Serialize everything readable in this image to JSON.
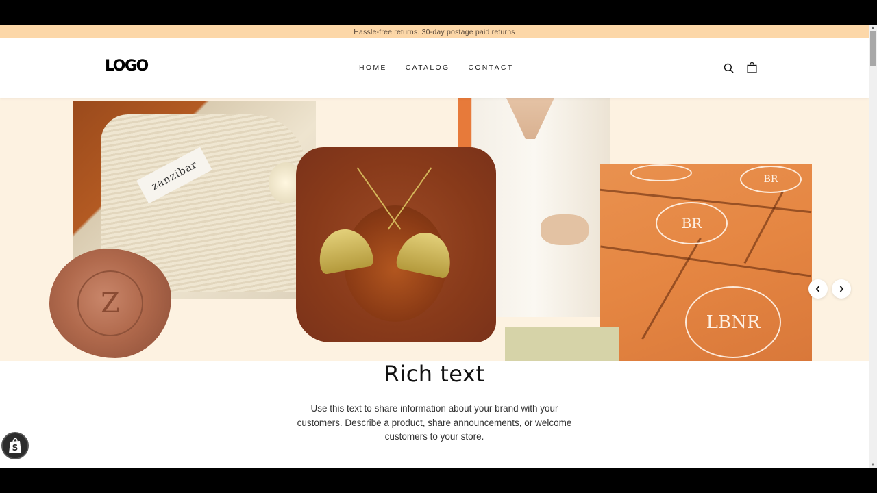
{
  "announcement": {
    "text": "Hassle-free returns. 30-day postage paid returns"
  },
  "header": {
    "logo": "LOGO",
    "nav": [
      {
        "label": "HOME"
      },
      {
        "label": "CATALOG"
      },
      {
        "label": "CONTACT"
      }
    ],
    "icons": {
      "search": "search-icon",
      "cart": "shopping-bag-icon"
    }
  },
  "hero": {
    "images": [
      {
        "name": "fabric-pouch-photo",
        "label_text": "zanzibar"
      },
      {
        "name": "wax-seal-photo",
        "seal_letter": "Z"
      },
      {
        "name": "ginkgo-earrings-photo"
      },
      {
        "name": "white-dress-photo"
      },
      {
        "name": "orange-boxes-photo",
        "monogram": "LBNR"
      },
      {
        "name": "sage-swatch-photo"
      }
    ],
    "prev_label": "‹",
    "next_label": "›"
  },
  "rich_text": {
    "heading": "Rich text",
    "body": "Use this text to share information about your brand with your customers. Describe a product, share announcements, or welcome customers to your store."
  },
  "badge": {
    "icon": "shopify-bag-icon",
    "letter": "S"
  },
  "colors": {
    "announcement_bg": "#fcd7a8",
    "hero_bg": "#fdf2e1",
    "accent_orange": "#e58642"
  }
}
